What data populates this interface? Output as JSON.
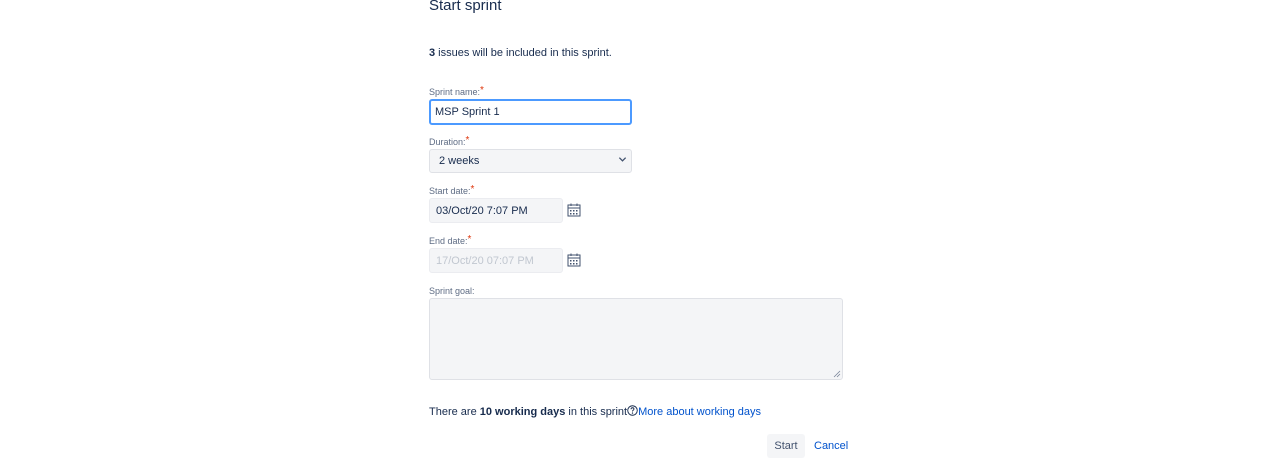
{
  "dialog": {
    "title": "Start sprint",
    "issues_count": "3",
    "issues_text": " issues will be included in this sprint."
  },
  "form": {
    "sprint_name": {
      "label": "Sprint name:",
      "required": "*",
      "value": "MSP Sprint 1"
    },
    "duration": {
      "label": "Duration:",
      "required": "*",
      "value": "2 weeks"
    },
    "start_date": {
      "label": "Start date:",
      "required": "*",
      "value": "03/Oct/20 7:07 PM"
    },
    "end_date": {
      "label": "End date:",
      "required": "*",
      "value": "17/Oct/20 07:07 PM"
    },
    "sprint_goal": {
      "label": "Sprint goal:",
      "value": ""
    }
  },
  "footer": {
    "working_prefix": "There are ",
    "working_days": "10 working days",
    "working_suffix": " in this sprint",
    "more_link": "More about working days",
    "start_label": "Start",
    "cancel_label": "Cancel"
  },
  "colors": {
    "accent": "#0052cc",
    "required": "#de350b",
    "focus": "#4c9aff"
  },
  "icons": {
    "date_picker": "calendar-icon",
    "duration": "chevron-down-icon",
    "help": "help-icon"
  }
}
